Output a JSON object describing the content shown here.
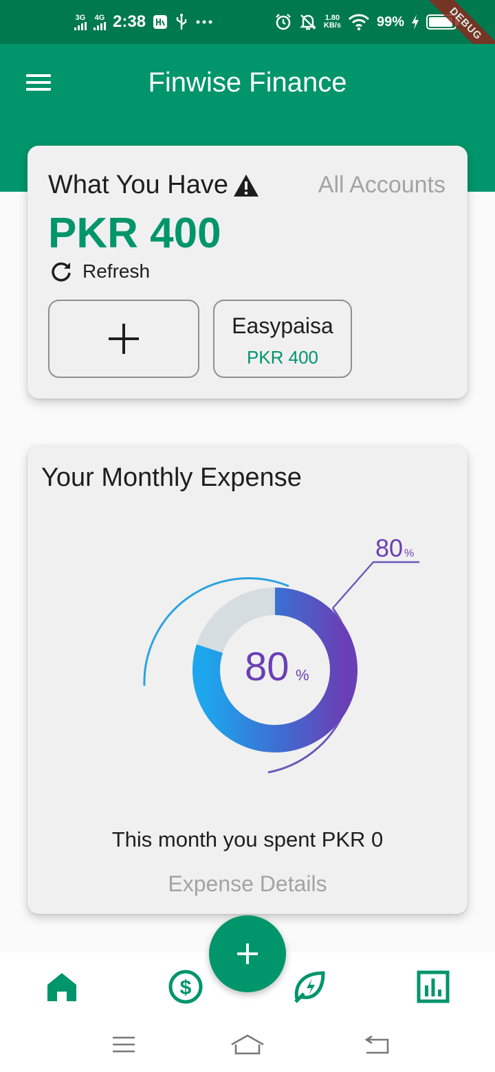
{
  "status_bar": {
    "net1": "3G",
    "net2": "4G",
    "time": "2:38",
    "speed_value": "1.80",
    "speed_unit": "KB/s",
    "battery": "99%",
    "debug_label": "DEBUG"
  },
  "app_bar": {
    "title": "Finwise Finance",
    "menu_icon": "hamburger-menu-icon"
  },
  "balance_card": {
    "title": "What You Have",
    "warning_icon": "warning-icon",
    "all_accounts": "All Accounts",
    "amount": "PKR 400",
    "refresh_label": "Refresh",
    "add_icon": "plus-icon",
    "accounts": [
      {
        "name": "Easypaisa",
        "amount": "PKR 400"
      }
    ]
  },
  "expense_card": {
    "title": "Your Monthly Expense",
    "gauge_center_value": "80",
    "gauge_center_unit": "%",
    "gauge_callout_value": "80",
    "gauge_callout_unit": "%",
    "gauge_fraction": 0.8,
    "spent_text": "This month you spent PKR 0",
    "details_link": "Expense Details"
  },
  "bottom_nav": {
    "items": [
      "home-icon",
      "dollar-icon",
      "eco-leaf-icon",
      "bar-chart-icon"
    ],
    "fab_icon": "plus-icon"
  },
  "system_nav": [
    "menu-icon",
    "home-icon",
    "back-icon"
  ],
  "colors": {
    "status_bar": "#00794f",
    "primary": "#00956a",
    "card_bg": "#f0f0f0",
    "muted_text": "#a3a3a3",
    "gauge_purple": "#6a3fb5",
    "gauge_blue": "#1ea6ec"
  }
}
